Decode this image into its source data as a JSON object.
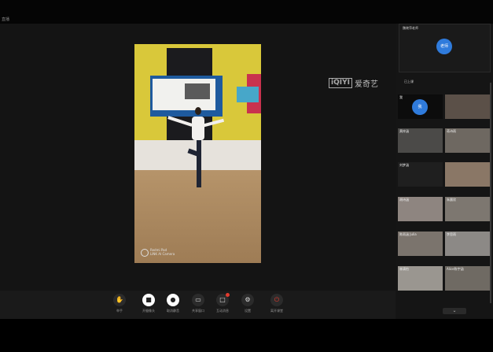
{
  "window": {
    "title": "直播"
  },
  "main_video": {
    "watermark_line1": "Redmi Pad",
    "watermark_line2": "LINK AI Camera",
    "player_logo": "iQIYI",
    "player_name": "爱奇艺"
  },
  "controls": [
    {
      "label": "举手",
      "icon": "raise-hand-icon"
    },
    {
      "label": "开摄像头",
      "icon": "camera-icon"
    },
    {
      "label": "取消静音",
      "icon": "microphone-icon"
    },
    {
      "label": "共享窗口",
      "icon": "screen-share-icon"
    },
    {
      "label": "互动消息",
      "icon": "message-icon"
    },
    {
      "label": "设置",
      "icon": "gear-icon"
    },
    {
      "label": "离开课堂",
      "icon": "power-icon"
    }
  ],
  "sidebar": {
    "teacher_title": "魏晓萍老师",
    "teacher_avatar": "老师",
    "section_title": "已上课",
    "me_avatar": "我",
    "students": [
      {
        "name": "我"
      },
      {
        "name": ""
      },
      {
        "name": "黄梓涵"
      },
      {
        "name": "蒋诗雨"
      },
      {
        "name": "刘梦涵"
      },
      {
        "name": ""
      },
      {
        "name": "胡诗涵"
      },
      {
        "name": "朱晨欣"
      },
      {
        "name": "陈雨涵 Julia"
      },
      {
        "name": "李思雨"
      },
      {
        "name": "林清怡"
      },
      {
        "name": "Alice陈宇涵"
      }
    ]
  },
  "colors": {
    "accent": "#2f7bdc",
    "danger": "#e23b2e"
  }
}
